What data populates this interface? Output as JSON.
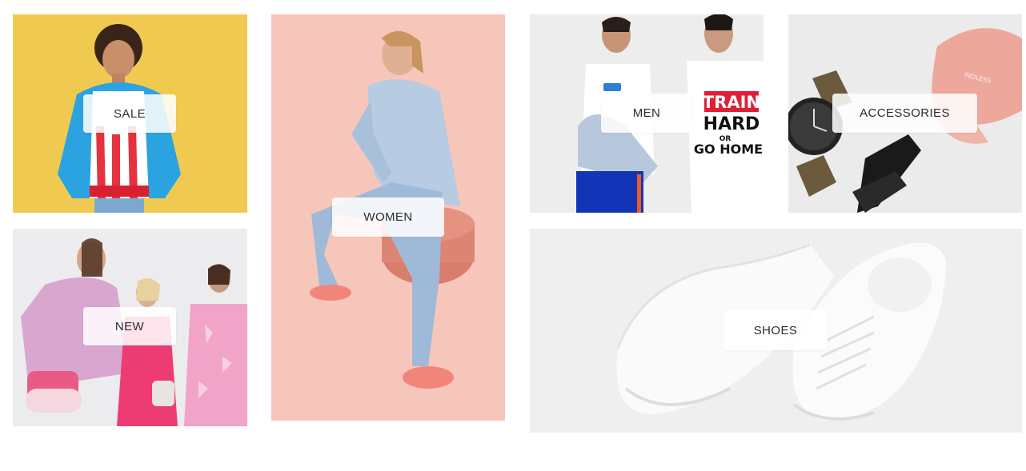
{
  "categories": {
    "sale": {
      "label": "SALE"
    },
    "new": {
      "label": "NEW"
    },
    "women": {
      "label": "WOMEN"
    },
    "men": {
      "label": "MEN",
      "tshirt_print": {
        "line1": "TRAIN",
        "line2": "HARD",
        "line3": "OR",
        "line4": "GO HOME"
      }
    },
    "accessories": {
      "label": "ACCESSORIES"
    },
    "shoes": {
      "label": "SHOES"
    }
  },
  "colors": {
    "sale_bg": "#efc64a",
    "women_bg": "#f7c6ba",
    "men_bg": "#ededed",
    "accessories_bg": "#ebebeb",
    "shoes_bg": "#efefef",
    "label_text": "#2b2b2b"
  }
}
